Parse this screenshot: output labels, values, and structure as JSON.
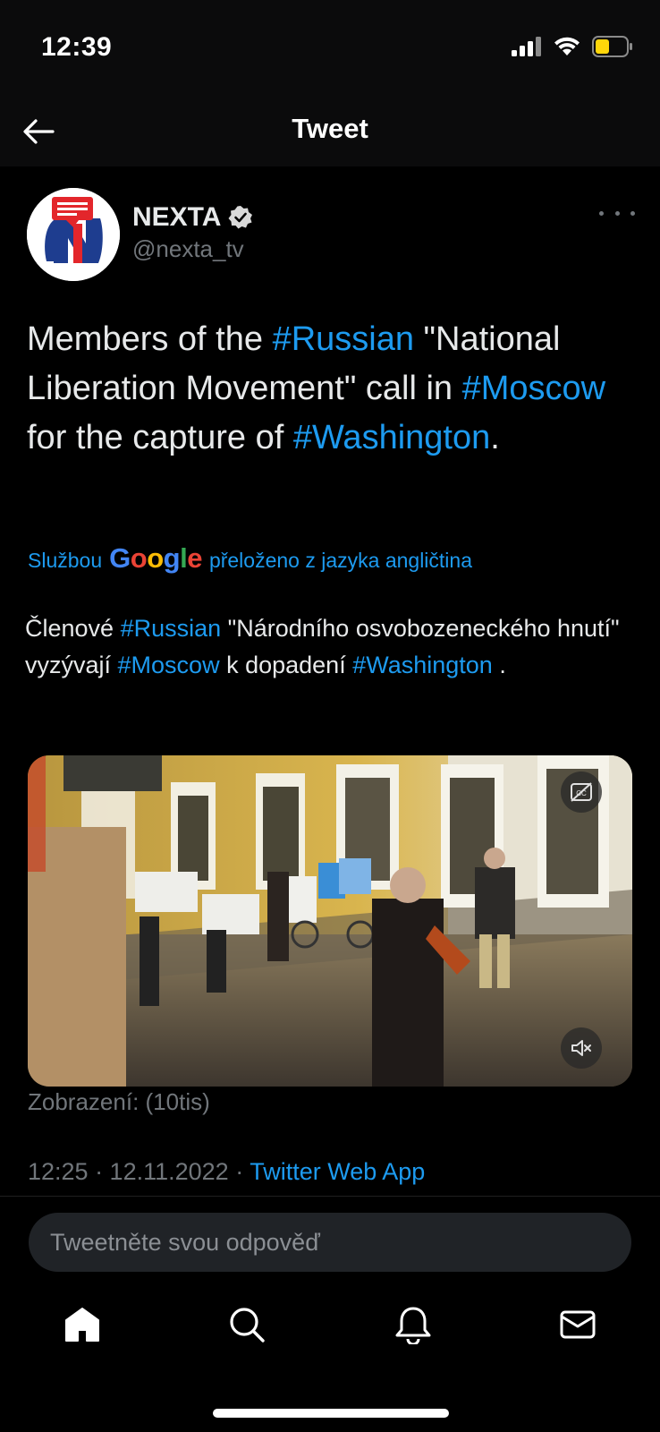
{
  "status_bar": {
    "time": "12:39",
    "icons": [
      "signal-icon",
      "wifi-icon",
      "battery-icon"
    ],
    "battery_color": "#ffd60a"
  },
  "nav": {
    "back_icon": "arrow-left-icon",
    "title": "Tweet"
  },
  "tweet": {
    "author": {
      "name": "NEXTA",
      "handle": "@nexta_tv",
      "verified_icon": "verified-badge-icon",
      "avatar_colors": [
        "#e3262b",
        "#1e3d8f",
        "#ffffff"
      ]
    },
    "more_icon": "more-horizontal-icon",
    "text_segments": [
      {
        "text": "Members of the ",
        "hashtag": false
      },
      {
        "text": "#Russian",
        "hashtag": true
      },
      {
        "text": " \"National Liberation Movement\" call in ",
        "hashtag": false
      },
      {
        "text": "#Moscow",
        "hashtag": true
      },
      {
        "text": " for the capture of ",
        "hashtag": false
      },
      {
        "text": "#Washington",
        "hashtag": true
      },
      {
        "text": ".",
        "hashtag": false
      }
    ],
    "translation": {
      "prefix": "Službou",
      "google_logo": [
        "G",
        "o",
        "o",
        "g",
        "l",
        "e"
      ],
      "suffix": "přeloženo z jazyka angličtina"
    },
    "translated_segments": [
      {
        "text": "Členové ",
        "hashtag": false
      },
      {
        "text": "#Russian",
        "hashtag": true
      },
      {
        "text": " \"Národního osvobozeneckého hnutí\" vyzývají ",
        "hashtag": false
      },
      {
        "text": "#Moscow",
        "hashtag": true
      },
      {
        "text": " k dopadení ",
        "hashtag": false
      },
      {
        "text": "#Washington",
        "hashtag": true
      },
      {
        "text": " .",
        "hashtag": false
      }
    ],
    "media": {
      "type": "video",
      "captions_icon": "closed-captions-off-icon",
      "mute_icon": "volume-muted-icon"
    },
    "views": "Zobrazení: (10tis)",
    "timestamp": {
      "time_date": "12:25 · 12.11.2022 ·",
      "app": "Twitter Web App"
    }
  },
  "reply": {
    "placeholder": "Tweetněte svou odpověď"
  },
  "tab_bar": {
    "tabs": [
      {
        "name": "home",
        "icon": "home-icon"
      },
      {
        "name": "search",
        "icon": "search-icon"
      },
      {
        "name": "notifications",
        "icon": "bell-icon"
      },
      {
        "name": "messages",
        "icon": "mail-icon"
      }
    ]
  },
  "colors": {
    "accent": "#1d9bf0",
    "background": "#000000",
    "header_bg": "#0b0b0c",
    "secondary_text": "#71767b"
  }
}
